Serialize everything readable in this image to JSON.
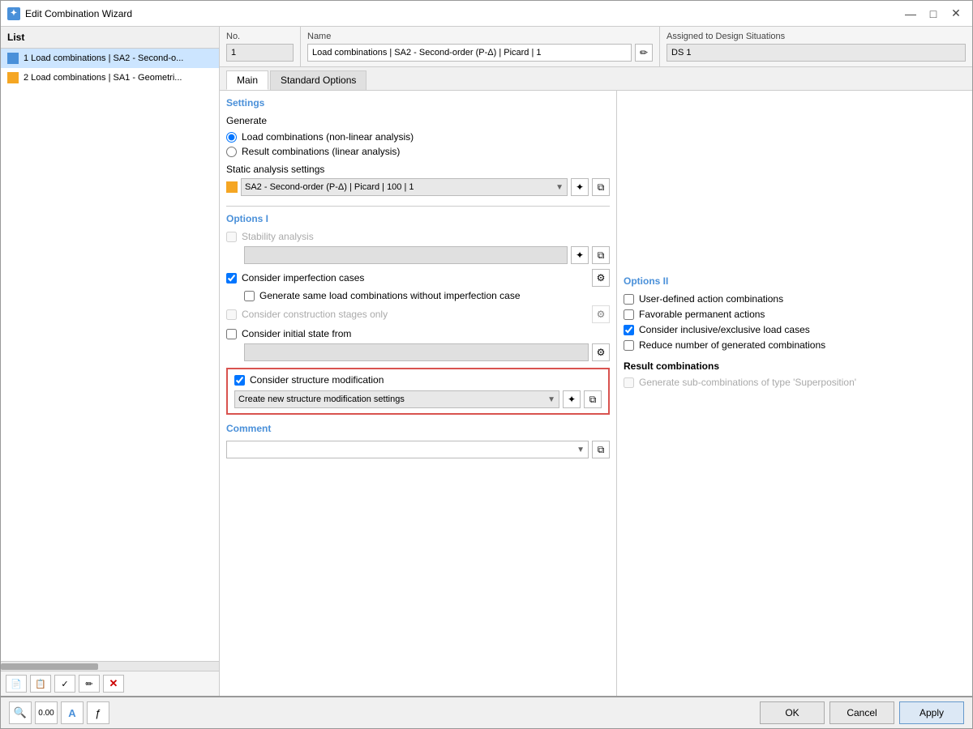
{
  "window": {
    "title": "Edit Combination Wizard",
    "icon": "✦"
  },
  "list": {
    "header": "List",
    "items": [
      {
        "id": 1,
        "text": "1  Load combinations | SA2 - Second-o...",
        "icon": "blue",
        "selected": true
      },
      {
        "id": 2,
        "text": "2  Load combinations | SA1 - Geometri...",
        "icon": "yellow",
        "selected": false
      }
    ]
  },
  "no_field": {
    "label": "No.",
    "value": "1"
  },
  "name_field": {
    "label": "Name",
    "value": "Load combinations | SA2 - Second-order (P-Δ) | Picard | 1"
  },
  "assigned_field": {
    "label": "Assigned to Design Situations",
    "value": "DS 1"
  },
  "tabs": [
    {
      "id": "main",
      "label": "Main",
      "active": true
    },
    {
      "id": "standard",
      "label": "Standard Options",
      "active": false
    }
  ],
  "settings": {
    "title": "Settings",
    "generate_label": "Generate",
    "radio_options": [
      {
        "id": "load-combo",
        "label": "Load combinations (non-linear analysis)",
        "checked": true
      },
      {
        "id": "result-combo",
        "label": "Result combinations (linear analysis)",
        "checked": false
      }
    ],
    "static_analysis_label": "Static analysis settings",
    "static_analysis_value": "SA2 - Second-order (P-Δ) | Picard | 100 | 1"
  },
  "options_i": {
    "title": "Options I",
    "stability": {
      "label": "Stability analysis",
      "checked": false,
      "disabled": true
    },
    "consider_imperfection": {
      "label": "Consider imperfection cases",
      "checked": true,
      "sub_label": "Generate same load combinations without imperfection case",
      "sub_checked": false
    },
    "consider_construction": {
      "label": "Consider construction stages only",
      "checked": false,
      "disabled": true
    },
    "consider_initial": {
      "label": "Consider initial state from",
      "checked": false
    },
    "structure_modification": {
      "label": "Consider structure modification",
      "checked": true,
      "dropdown_value": "Create new structure modification settings",
      "highlighted": true
    }
  },
  "options_ii": {
    "title": "Options II",
    "items": [
      {
        "label": "User-defined action combinations",
        "checked": false
      },
      {
        "label": "Favorable permanent actions",
        "checked": false
      },
      {
        "label": "Consider inclusive/exclusive load cases",
        "checked": true
      },
      {
        "label": "Reduce number of generated combinations",
        "checked": false
      }
    ]
  },
  "result_combinations": {
    "title": "Result combinations",
    "items": [
      {
        "label": "Generate sub-combinations of type 'Superposition'",
        "checked": false,
        "disabled": true
      }
    ]
  },
  "comment": {
    "title": "Comment",
    "value": ""
  },
  "buttons": {
    "ok": "OK",
    "cancel": "Cancel",
    "apply": "Apply"
  },
  "icons": {
    "search": "🔍",
    "input": "0.00",
    "text": "A",
    "func": "ƒ",
    "new": "📄",
    "copy": "📋",
    "validate": "✓",
    "edit": "✏",
    "delete": "✗",
    "settings": "⚙",
    "pencil": "✏",
    "dropdown": "▼",
    "new_item": "✦",
    "copy_item": "⧉"
  }
}
